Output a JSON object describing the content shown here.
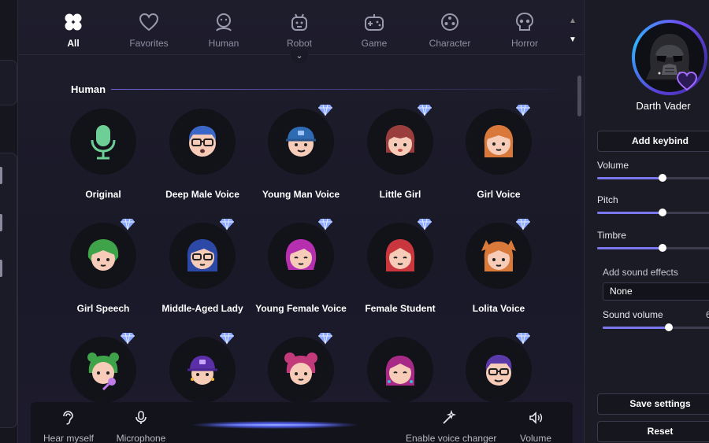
{
  "categories": [
    {
      "label": "All",
      "icon": "clover-icon",
      "active": true
    },
    {
      "label": "Favorites",
      "icon": "heart-icon",
      "active": false
    },
    {
      "label": "Human",
      "icon": "human-face-icon",
      "active": false
    },
    {
      "label": "Robot",
      "icon": "robot-icon",
      "active": false
    },
    {
      "label": "Game",
      "icon": "gamepad-icon",
      "active": false
    },
    {
      "label": "Character",
      "icon": "character-icon",
      "active": false
    },
    {
      "label": "Horror",
      "icon": "skull-icon",
      "active": false
    }
  ],
  "section": {
    "title": "Human"
  },
  "voices": [
    {
      "label": "Original",
      "icon": "microphone-icon",
      "premium": false
    },
    {
      "label": "Deep Male Voice",
      "icon": "man-glasses-icon",
      "premium": false
    },
    {
      "label": "Young Man Voice",
      "icon": "young-man-cap-icon",
      "premium": true
    },
    {
      "label": "Little Girl",
      "icon": "little-girl-icon",
      "premium": true
    },
    {
      "label": "Girl Voice",
      "icon": "girl-icon",
      "premium": true
    },
    {
      "label": "Girl Speech",
      "icon": "girl-green-hair-icon",
      "premium": true
    },
    {
      "label": "Middle-Aged Lady",
      "icon": "lady-glasses-icon",
      "premium": true
    },
    {
      "label": "Young Female Voice",
      "icon": "young-female-icon",
      "premium": true
    },
    {
      "label": "Female Student",
      "icon": "female-student-icon",
      "premium": true
    },
    {
      "label": "Lolita Voice",
      "icon": "lolita-icon",
      "premium": true
    },
    {
      "label": "",
      "icon": "girl-mic-icon",
      "premium": true
    },
    {
      "label": "",
      "icon": "girl-purple-cap-icon",
      "premium": true
    },
    {
      "label": "",
      "icon": "girl-pink-buns-icon",
      "premium": true
    },
    {
      "label": "",
      "icon": "girl-magenta-icon",
      "premium": false
    },
    {
      "label": "",
      "icon": "man-purple-hair-icon",
      "premium": true
    }
  ],
  "bottom_bar": {
    "hear_myself": "Hear myself",
    "microphone": "Microphone",
    "enable_voice_changer": "Enable voice changer",
    "volume": "Volume"
  },
  "profile": {
    "name": "Darth Vader",
    "icon": "darth-vader-icon"
  },
  "panel": {
    "add_keybind": "Add keybind",
    "sliders": [
      {
        "label": "Volume",
        "value": 0.55
      },
      {
        "label": "Pitch",
        "value": 0.55
      },
      {
        "label": "Timbre",
        "value": 0.55
      }
    ],
    "sound_effects_label": "Add sound effects",
    "sound_effects_value": "None",
    "sound_volume_label": "Sound volume",
    "sound_volume_value": "6",
    "sound_volume_level": 0.6,
    "save_settings": "Save settings",
    "reset": "Reset"
  },
  "colors": {
    "accent": "#7b77ee",
    "premium": "#8aa8ff",
    "background": "#141420"
  }
}
